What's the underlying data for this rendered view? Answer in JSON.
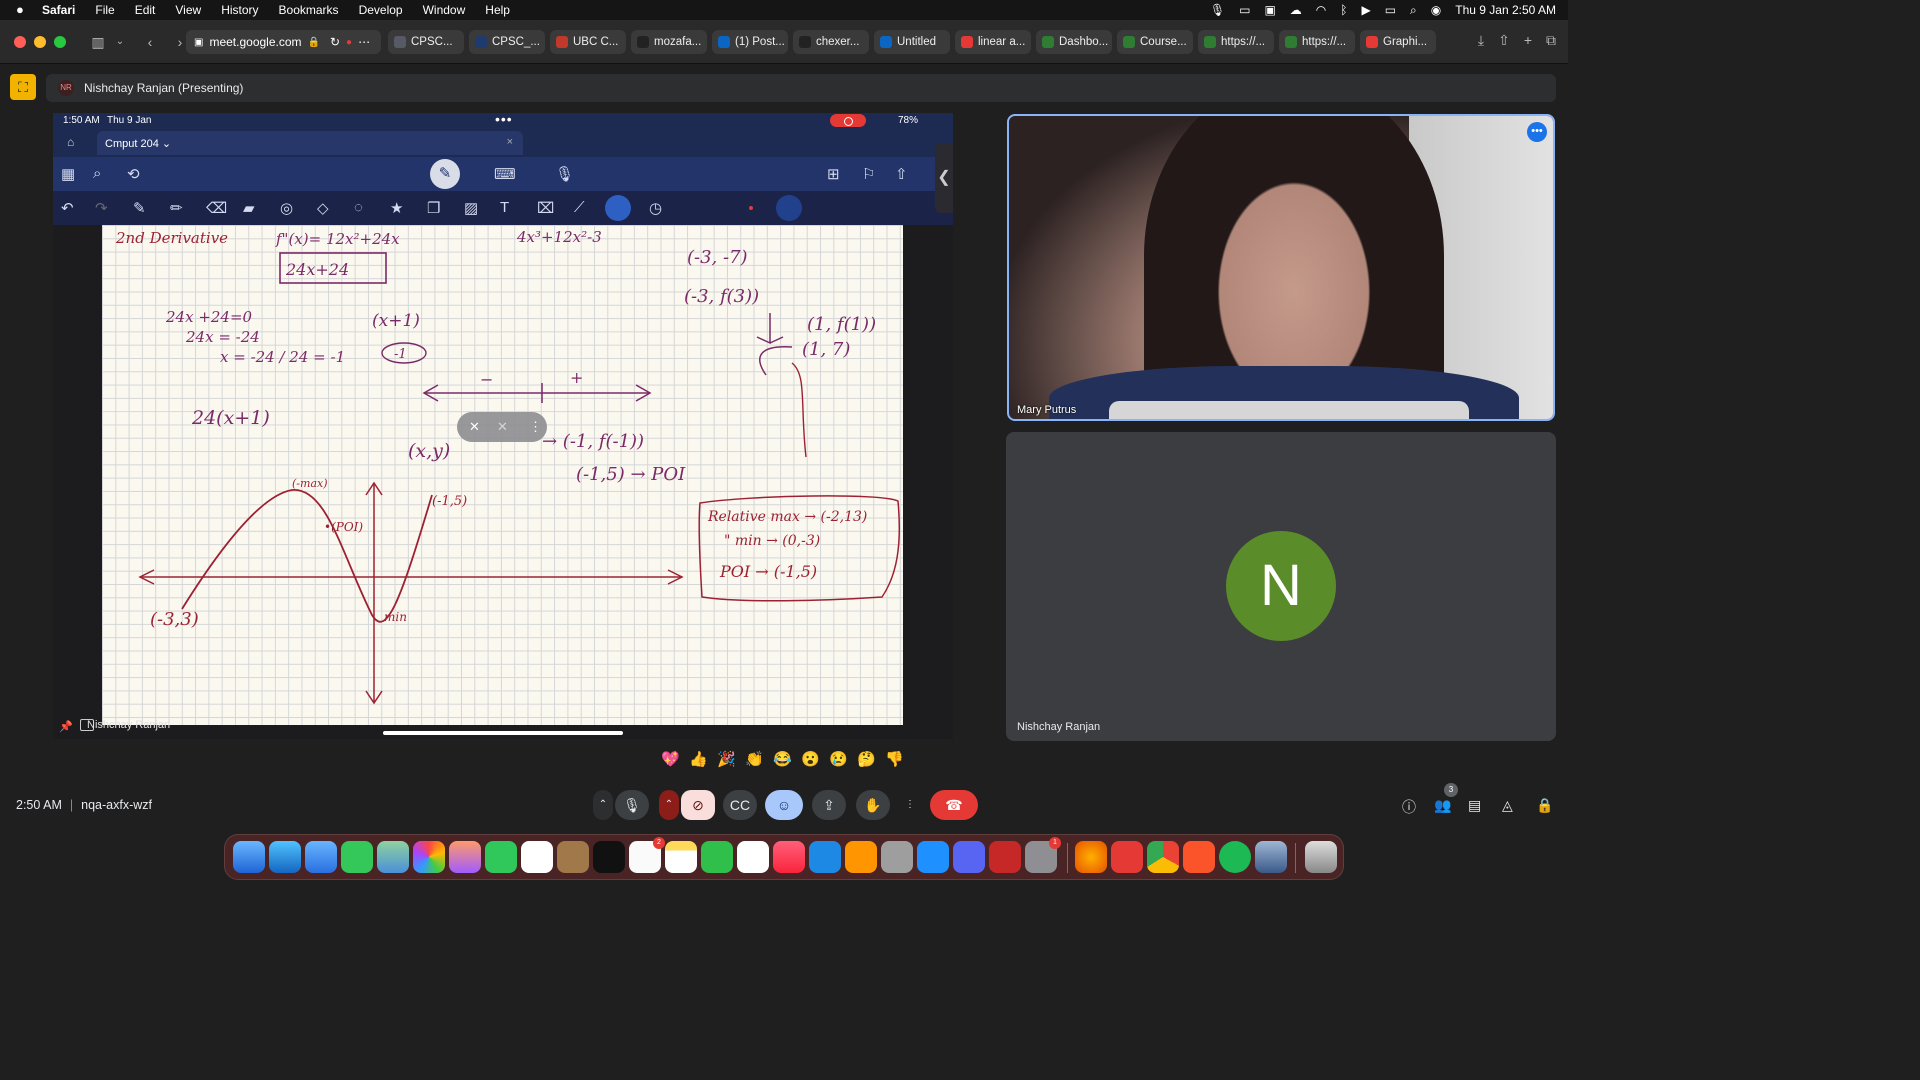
{
  "menubar": {
    "apple": "",
    "items": [
      "Safari",
      "File",
      "Edit",
      "View",
      "History",
      "Bookmarks",
      "Develop",
      "Window",
      "Help"
    ],
    "clock": "Thu 9 Jan  2:50 AM"
  },
  "safari": {
    "url": "meet.google.com",
    "tabs": [
      {
        "label": "CPSC...",
        "color": "#555a66"
      },
      {
        "label": "CPSC_...",
        "color": "#1f3a6e"
      },
      {
        "label": "UBC C...",
        "color": "#c0392b"
      },
      {
        "label": "mozafa...",
        "color": "#222222"
      },
      {
        "label": "(1) Post...",
        "color": "#0a66c2"
      },
      {
        "label": "chexer...",
        "color": "#222222"
      },
      {
        "label": "Untitled",
        "color": "#0a66c2"
      },
      {
        "label": "linear a...",
        "color": "#e53935"
      },
      {
        "label": "Dashbo...",
        "color": "#2e7d32"
      },
      {
        "label": "Course...",
        "color": "#2e7d32"
      },
      {
        "label": "https://...",
        "color": "#2e7d32"
      },
      {
        "label": "https://...",
        "color": "#2e7d32"
      },
      {
        "label": "Graphi...",
        "color": "#e53935"
      }
    ]
  },
  "meet": {
    "presenting": "Nishchay Ranjan (Presenting)",
    "presenter_initials": "NR",
    "time": "2:50 AM",
    "meeting_code": "nqa-axfx-wzf",
    "people_count": "3",
    "reactions": [
      "💖",
      "👍",
      "🎉",
      "👏",
      "😂",
      "😮",
      "😢",
      "🤔",
      "👎"
    ]
  },
  "ipad": {
    "status_time": "1:50 AM",
    "status_date": "Thu 9 Jan",
    "battery": "78%",
    "doc_title": "Cmput 204",
    "doc_title_chevron": "⌄",
    "share_name": "Nishchay Ranjan"
  },
  "notes": {
    "line1": "2nd Derivative",
    "fpp": "f\"(x)= 12x²+24x",
    "boxed": "24x+24",
    "cubic": "4x³+12x²-3",
    "pt1": "(-3, -7)",
    "pt2": "(-3, f(3))",
    "pt3": "(1, f(1))",
    "pt4": "(1, 7)",
    "eq1": "24x +24=0",
    "eq2": "24x = -24",
    "eq3": "x = -24 / 24 = -1",
    "factor": "(x+1)",
    "neg1": "-1",
    "minus": "−",
    "plus": "+",
    "factored": "24(x+1)",
    "xy": "(x,y)",
    "arrow_f": "→ (-1, f(-1))",
    "poi_line": "(-1,5) → POI",
    "max_label": "(-max)",
    "poi_label": "•(POI)",
    "pt_top": "(-1,5)",
    "min_label": "min",
    "pt_bottom": "(-3,3)",
    "summary_max": "Relative max → (-2,13)",
    "summary_min": "\"  min → (0,-3)",
    "summary_poi": "POI → (-1,5)"
  },
  "participants": [
    {
      "name": "Mary Putrus"
    },
    {
      "name": "Nishchay Ranjan",
      "initial": "N",
      "avatar_color": "#5b8c2a"
    }
  ]
}
